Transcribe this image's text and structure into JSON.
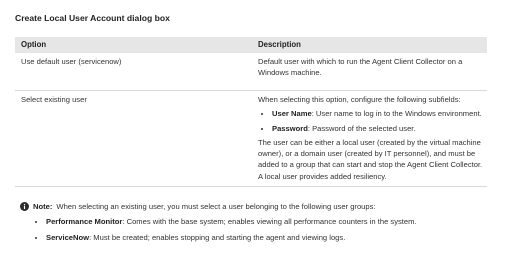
{
  "dialog_title": "Create Local User Account dialog box",
  "table": {
    "headers": [
      "Option",
      "Description"
    ],
    "rows": [
      {
        "option": "Use default user (servicenow)",
        "description": "Default user with which to run the Agent Client Collector on a Windows machine."
      },
      {
        "option": "Select existing user",
        "intro": "When selecting this option, configure the following subfields:",
        "subfields": [
          {
            "name": "User Name",
            "text": ": User name to log in to the Windows environment."
          },
          {
            "name": "Password",
            "text": ": Password of the selected user."
          }
        ],
        "details": "The user can be either a local user (created by the virtual machine owner), or a domain user (created by IT personnel), and must be added to a group that can start and stop the Agent Client Collector. A local user provides added resiliency."
      }
    ]
  },
  "note": {
    "icon": "info-icon",
    "label": "Note:",
    "text": "When selecting an existing user, you must select a user belonging to the following user groups:",
    "groups": [
      {
        "name": "Performance Monitor",
        "text": ": Comes with the base system; enables viewing all performance counters in the system."
      },
      {
        "name": "ServiceNow",
        "text": ": Must be created; enables stopping and starting the agent and viewing logs."
      }
    ]
  }
}
